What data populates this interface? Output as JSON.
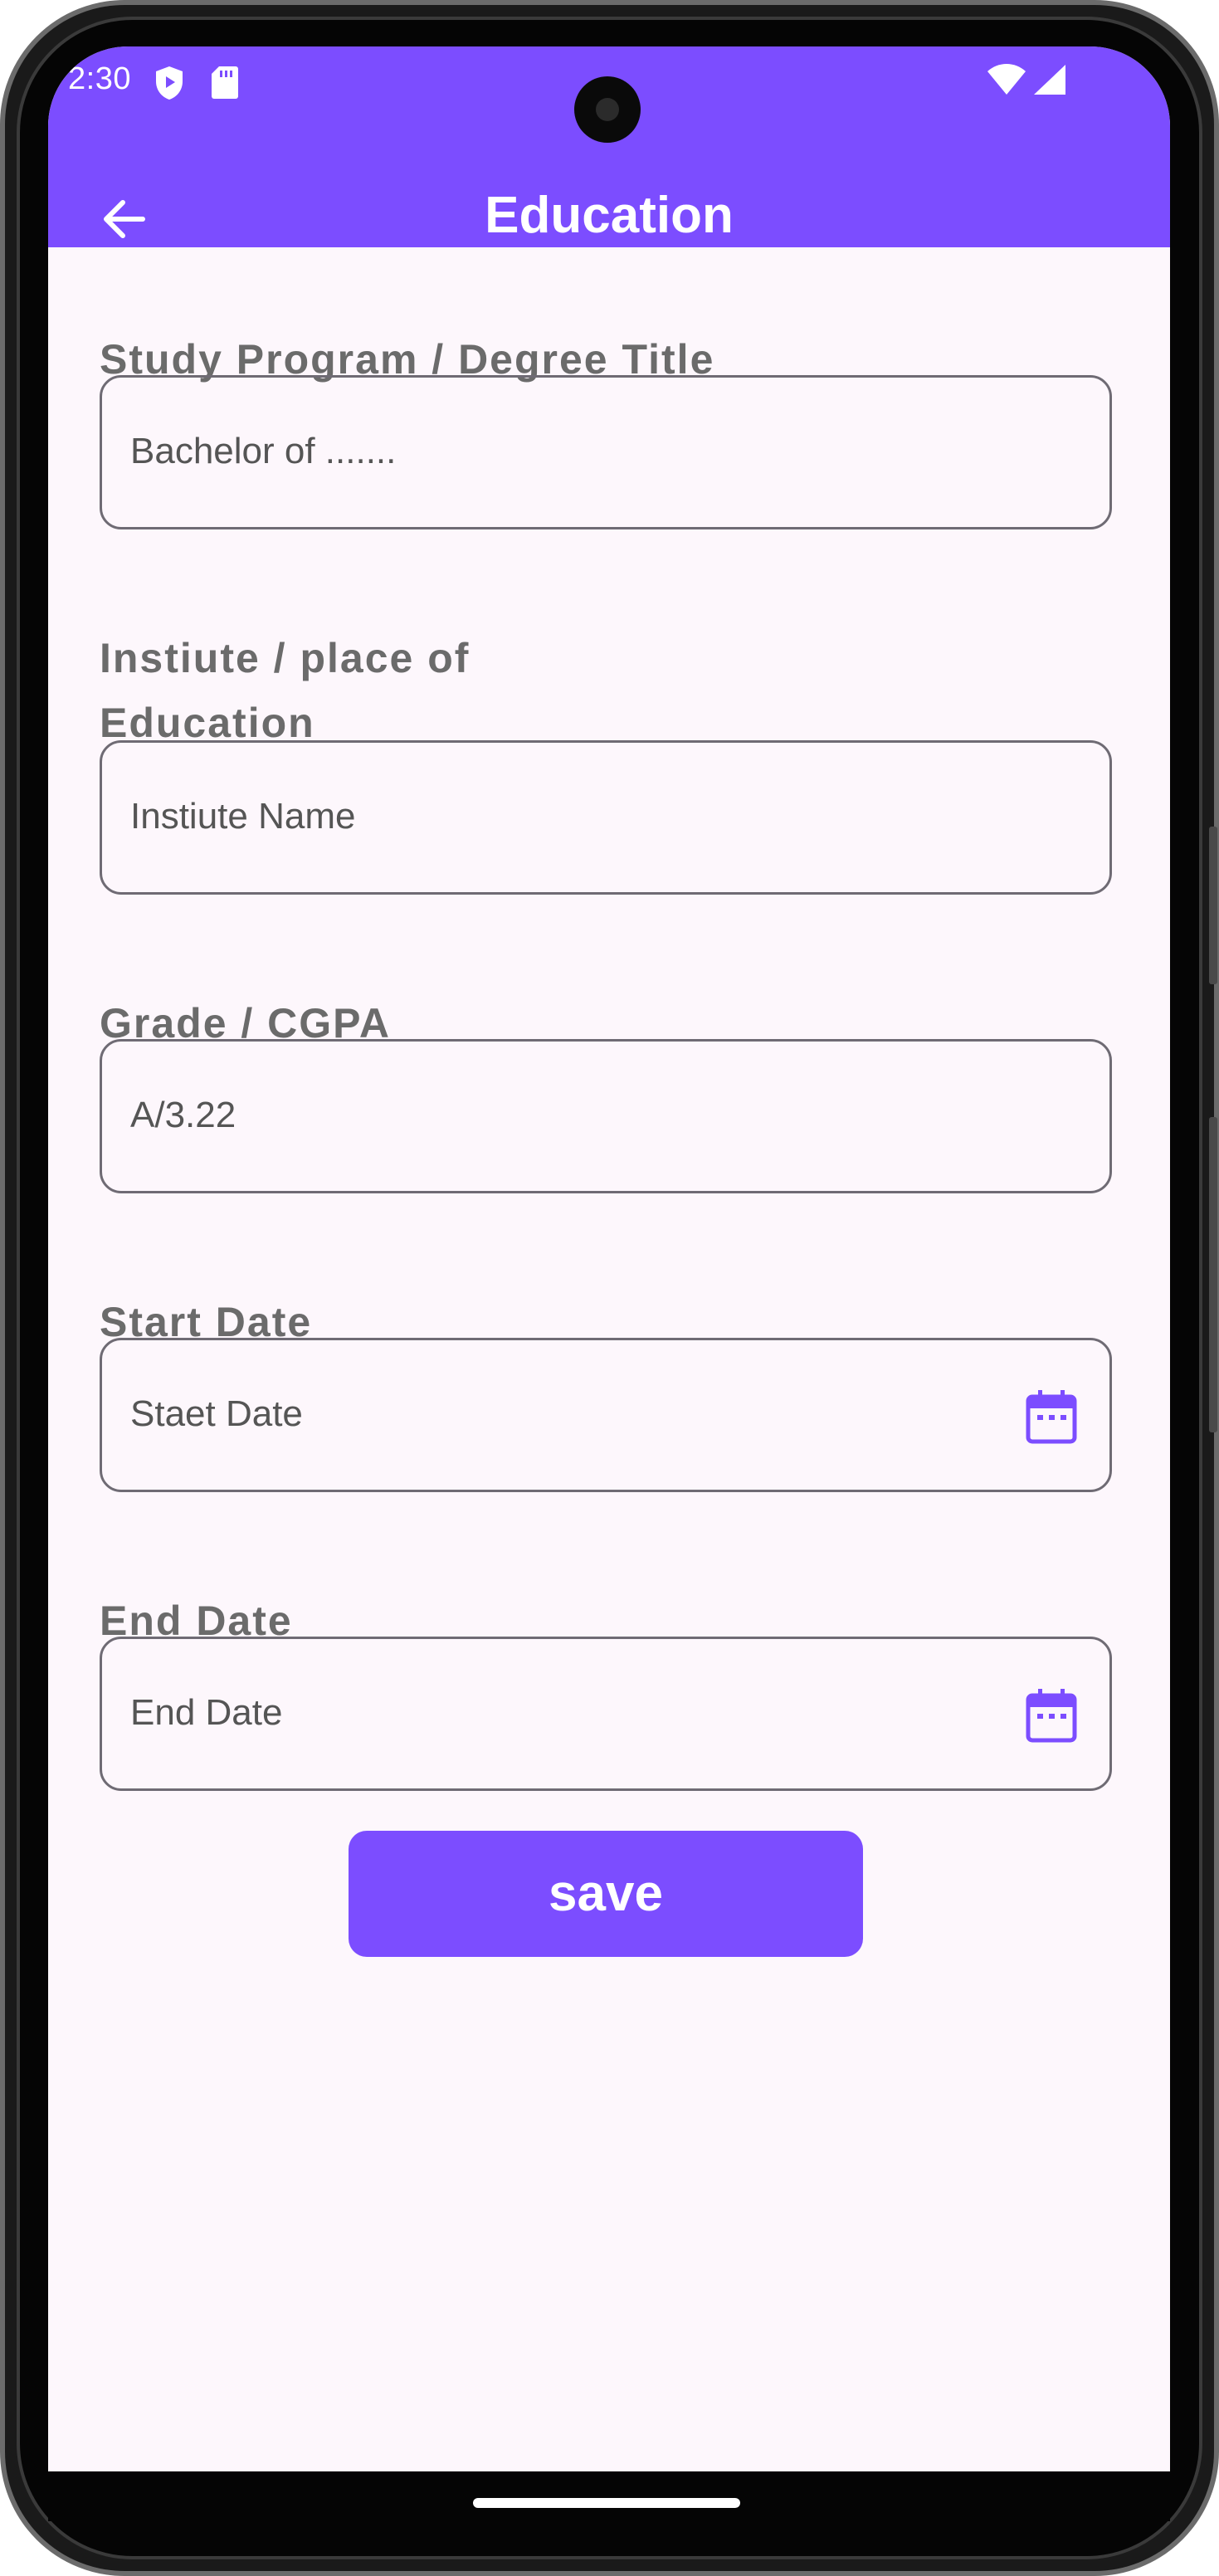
{
  "status_bar": {
    "time": "2:30"
  },
  "app_bar": {
    "title": "Education",
    "back_icon": "arrow-left-icon",
    "color": "#7c4dff"
  },
  "form": {
    "fields": [
      {
        "label": "Study Program / Degree Title",
        "placeholder": "Bachelor of ......."
      },
      {
        "label_line1": "Instiute / place of",
        "label_line2": "Education",
        "placeholder": "Instiute Name"
      },
      {
        "label": "Grade / CGPA",
        "placeholder": "A/3.22"
      },
      {
        "label": "Start Date",
        "placeholder": "Staet Date",
        "icon": "calendar-icon"
      },
      {
        "label": "End Date",
        "placeholder": "End Date",
        "icon": "calendar-icon"
      }
    ],
    "save_label": "save"
  },
  "colors": {
    "accent": "#7c4dff",
    "background": "#fdf7fc",
    "label": "#6b6b6b",
    "border": "#6f6b74"
  }
}
